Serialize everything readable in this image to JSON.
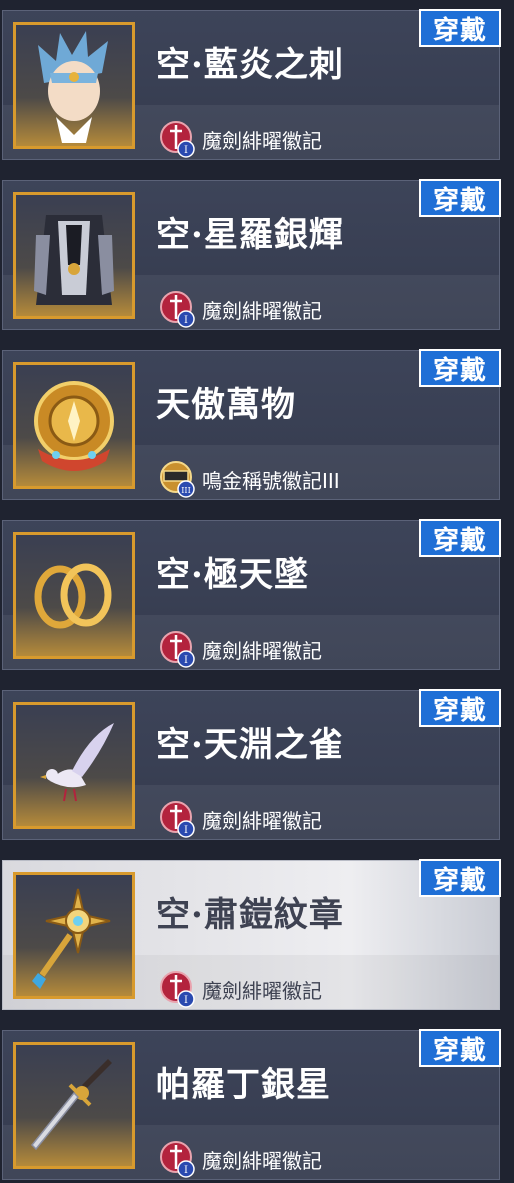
{
  "wear_label": "穿戴",
  "items": [
    {
      "name": "空·藍炎之刺",
      "badge": "魔劍緋曜徽記",
      "badge_type": "red",
      "icon": "blue-hair-portrait-icon",
      "selected": false
    },
    {
      "name": "空·星羅銀輝",
      "badge": "魔劍緋曜徽記",
      "badge_type": "red",
      "icon": "armored-outfit-icon",
      "selected": false
    },
    {
      "name": "天傲萬物",
      "badge": "鳴金稱號徽記III",
      "badge_type": "gold",
      "icon": "golden-emblem-icon",
      "selected": false
    },
    {
      "name": "空·極天墜",
      "badge": "魔劍緋曜徽記",
      "badge_type": "red",
      "icon": "golden-rings-icon",
      "selected": false
    },
    {
      "name": "空·天淵之雀",
      "badge": "魔劍緋曜徽記",
      "badge_type": "red",
      "icon": "white-bird-icon",
      "selected": false
    },
    {
      "name": "空·肅鎧紋章",
      "badge": "魔劍緋曜徽記",
      "badge_type": "red",
      "icon": "star-scepter-icon",
      "selected": true
    },
    {
      "name": "帕羅丁銀星",
      "badge": "魔劍緋曜徽記",
      "badge_type": "red",
      "icon": "silver-sword-icon",
      "selected": false
    }
  ],
  "colors": {
    "accent_blue": "#1f6fd6",
    "frame_gold": "#d89a2d",
    "badge_red": "#b3233d"
  }
}
